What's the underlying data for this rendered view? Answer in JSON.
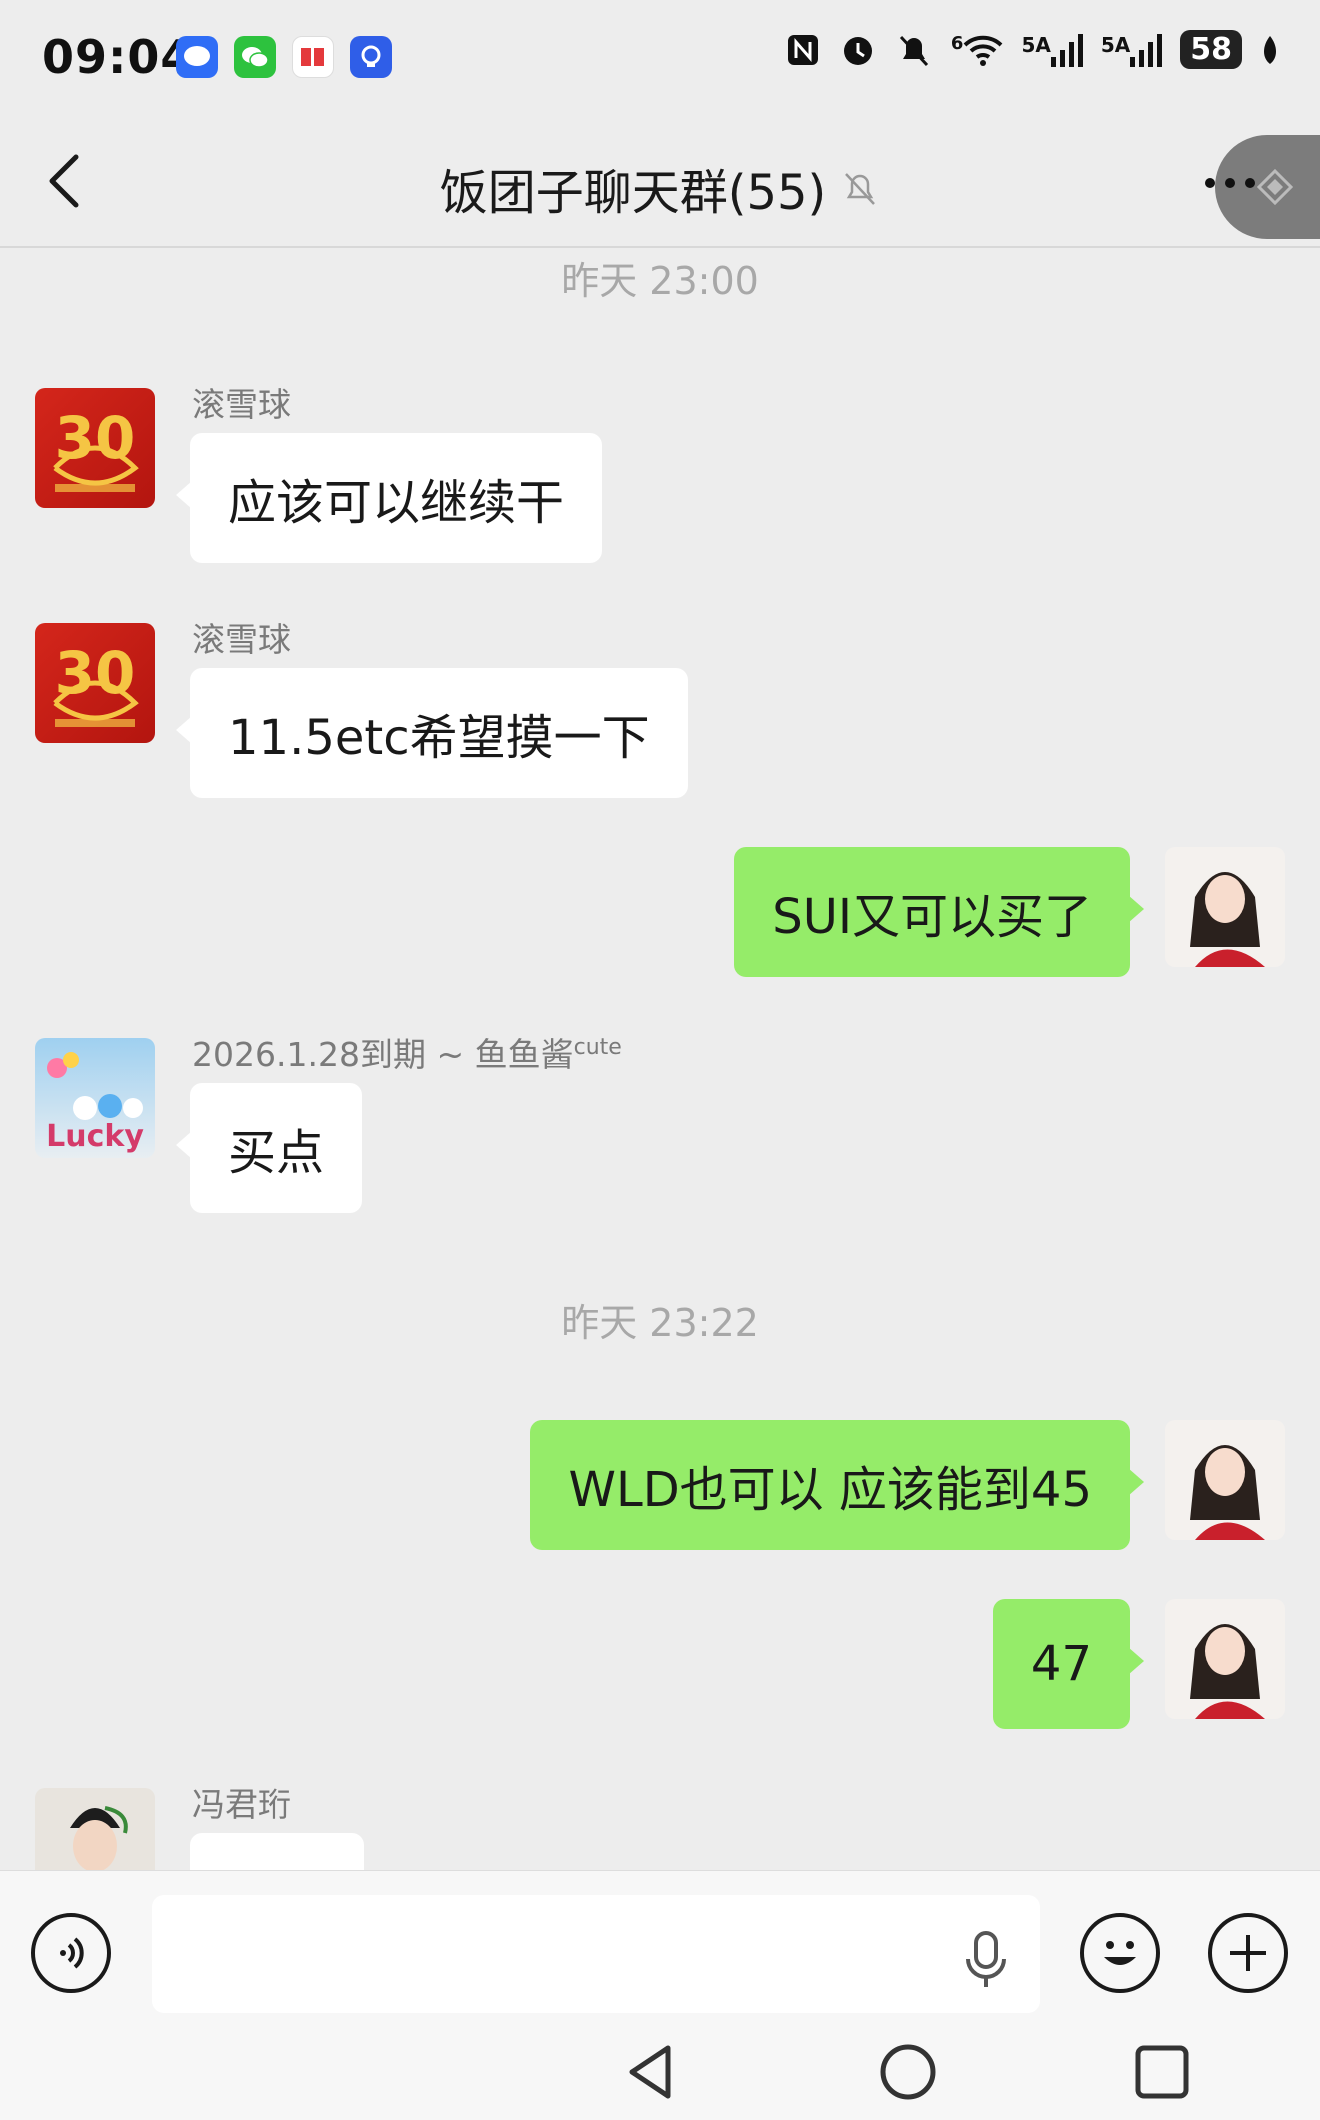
{
  "status_bar": {
    "time": "09:04",
    "app_icons": [
      {
        "name": "messages-app-icon",
        "color": "#2f6df6",
        "glyph": "●"
      },
      {
        "name": "wechat-app-icon",
        "color": "#2dc23e",
        "glyph": "✉"
      },
      {
        "name": "toutiao-app-icon",
        "color": "#ffffff",
        "glyph": "🀄"
      },
      {
        "name": "bulb-app-icon",
        "color": "#2f5ee8",
        "glyph": "♀"
      }
    ],
    "network_1": "5A",
    "network_2": "5A",
    "wifi": "6",
    "battery": "58"
  },
  "header": {
    "title": "饭团子聊天群(55)"
  },
  "messages": [
    {
      "kind": "time",
      "text": "昨天 23:00"
    },
    {
      "kind": "in",
      "sender": "滚雪球",
      "text": "应该可以继续干",
      "avatar": "snowball"
    },
    {
      "kind": "in",
      "sender": "滚雪球",
      "text": "11.5etc希望摸一下",
      "avatar": "snowball"
    },
    {
      "kind": "out",
      "text": "SUI又可以买了"
    },
    {
      "kind": "in",
      "sender": "2026.1.28到期 ~ 鱼鱼酱",
      "sender_sup": "cute",
      "text": "买点",
      "avatar": "lucky"
    },
    {
      "kind": "time",
      "text": "昨天 23:22"
    },
    {
      "kind": "out",
      "text": "WLD也可以 应该能到45"
    },
    {
      "kind": "out",
      "text": "47"
    },
    {
      "kind": "in",
      "sender": "冯君珩",
      "text": "",
      "avatar": "guy"
    }
  ],
  "input": {
    "placeholder": ""
  },
  "colors": {
    "outgoing_bubble": "#95ec69",
    "incoming_bubble": "#ffffff",
    "background": "#ededed"
  }
}
